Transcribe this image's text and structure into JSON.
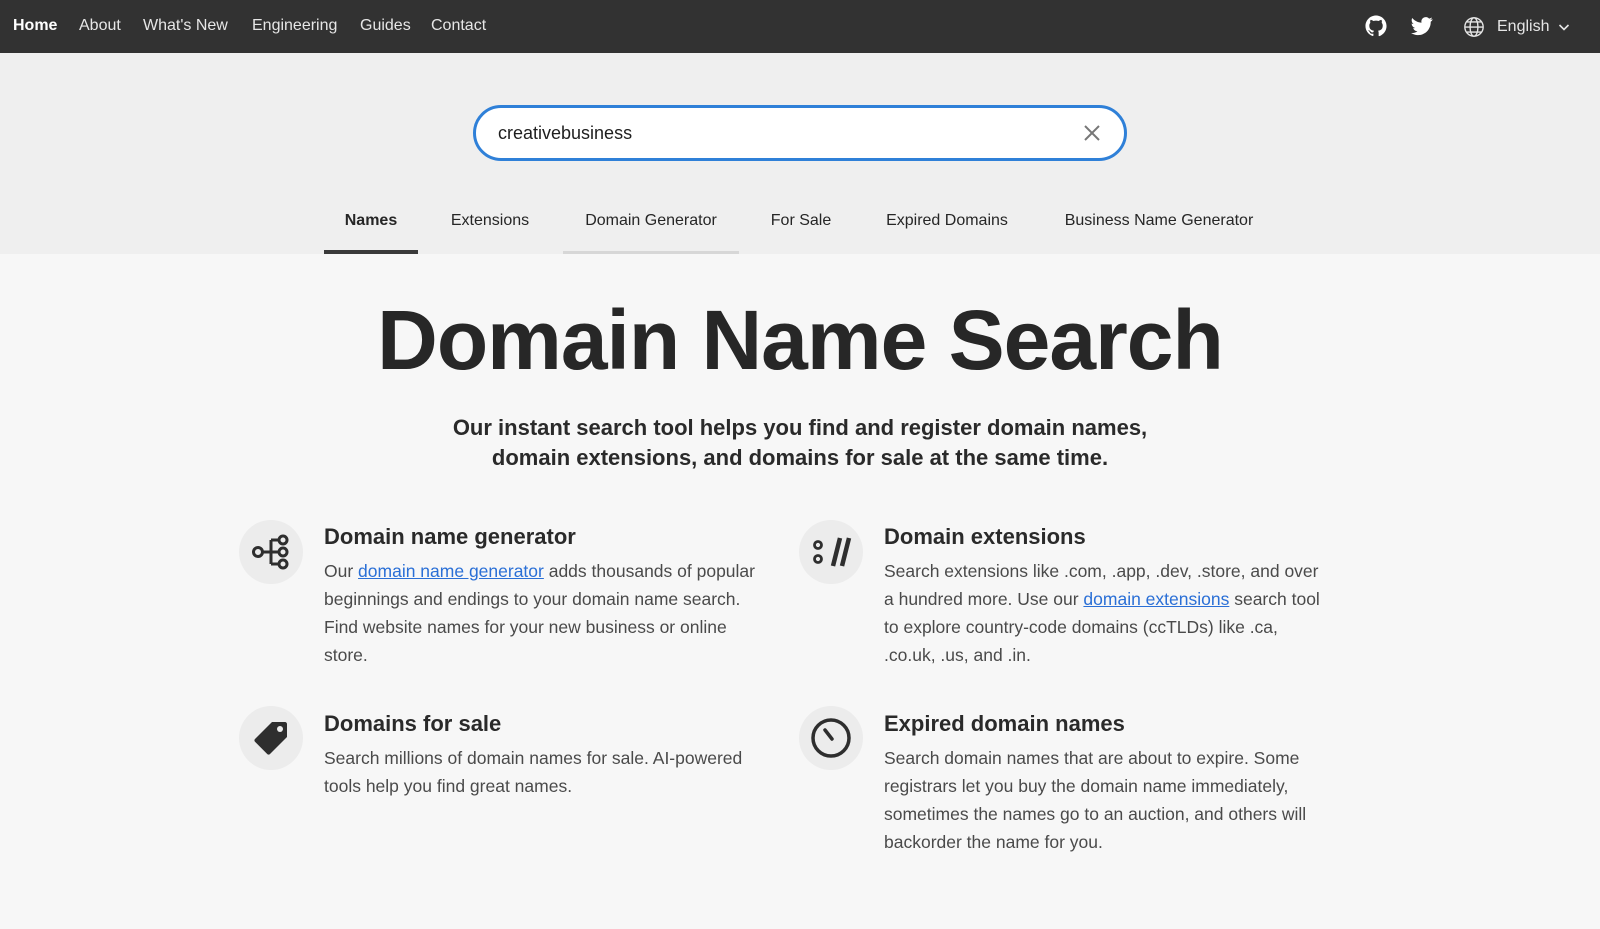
{
  "nav": {
    "links": [
      "Home",
      "About",
      "What's New",
      "Engineering",
      "Guides",
      "Contact"
    ],
    "icons": [
      "github-icon",
      "twitter-icon",
      "globe-icon"
    ],
    "language": "English"
  },
  "search": {
    "value": "creativebusiness"
  },
  "tabs": [
    "Names",
    "Extensions",
    "Domain Generator",
    "For Sale",
    "Expired Domains",
    "Business Name Generator"
  ],
  "hero": {
    "title": "Domain Name Search",
    "subtitle_line1": "Our instant search tool helps you find and register domain names,",
    "subtitle_line2": "domain extensions, and domains for sale at the same time."
  },
  "features": {
    "generator": {
      "title": "Domain name generator",
      "before": "Our ",
      "link": "domain name generator",
      "after": " adds thousands of popular beginnings and endings to your domain name search. Find website names for your new business or online store."
    },
    "extensions": {
      "title": "Domain extensions",
      "before": "Search extensions like .com, .app, .dev, .store, and over a hundred more. Use our ",
      "link": "domain extensions",
      "after": " search tool to explore country-code domains (ccTLDs) like .ca, .co.uk, .us, and .in."
    },
    "for_sale": {
      "title": "Domains for sale",
      "text": "Search millions of domain names for sale. AI-powered tools help you find great names."
    },
    "expired": {
      "title": "Expired domain names",
      "text": "Search domain names that are about to expire. Some registrars let you buy the domain name immediately, sometimes the names go to an auction, and others will backorder the name for you."
    }
  },
  "colors": {
    "topbar": "#323232",
    "accent_blue": "#2f80d8",
    "link": "#2a6fd6"
  }
}
